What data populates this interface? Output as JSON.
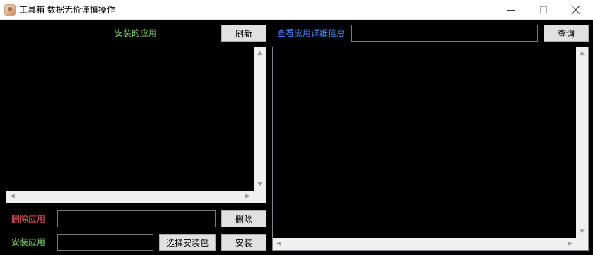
{
  "window": {
    "title": "工具箱 数据无价谨慎操作"
  },
  "left_panel": {
    "installed_apps_label": "安装的应用",
    "refresh_button": "刷新",
    "delete_label": "删除应用",
    "delete_button": "删除",
    "delete_input_value": "",
    "install_label": "安装应用",
    "select_package_button": "选择安装包",
    "install_button": "安装",
    "install_input_value": ""
  },
  "right_panel": {
    "view_details_label": "查看应用详细信息",
    "query_button": "查询",
    "query_input_value": ""
  },
  "icons": {
    "app": "app-avatar-icon",
    "minimize": "minimize-icon",
    "maximize": "maximize-icon",
    "close": "close-icon",
    "scroll_up": "chevron-up-icon",
    "scroll_down": "chevron-down-icon",
    "scroll_left": "chevron-left-icon",
    "scroll_right": "chevron-right-icon"
  },
  "colors": {
    "label_green": "#7fd16e",
    "label_blue": "#4f88ff",
    "label_red": "#ff5a6e",
    "background": "#000000"
  }
}
